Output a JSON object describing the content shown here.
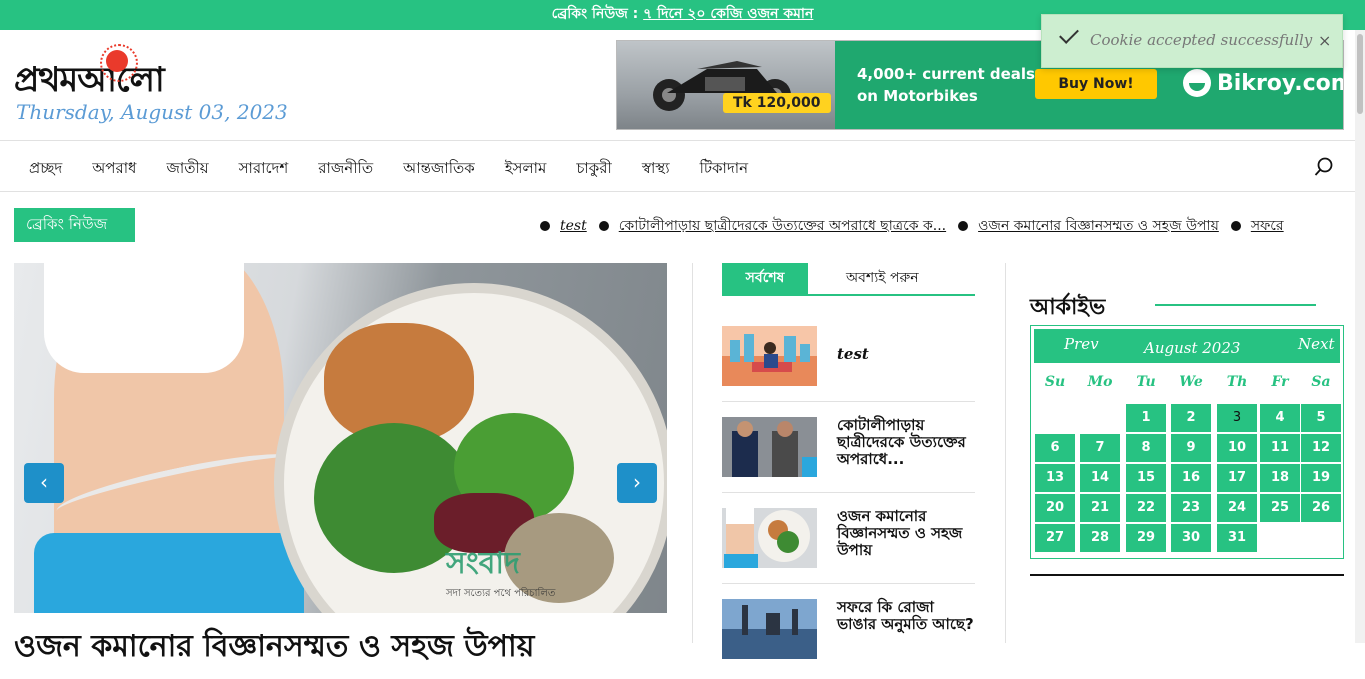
{
  "topbar": {
    "label": "ব্রেকিং নিউজ :",
    "link": "৭ দিনে ২০ কেজি ওজন কমান"
  },
  "header": {
    "logo_text": "প্রথমআলো",
    "date": "Thursday, August 03, 2023"
  },
  "ad": {
    "price": "Tk 120,000",
    "line1": "4,000+ current deals",
    "line2": "on Motorbikes",
    "button": "Buy Now!",
    "brand": "Bikroy.com",
    "colors": {
      "bg": "#1fa86f",
      "button": "#ffc800"
    }
  },
  "toast": {
    "message": "Cookie accepted successfully",
    "close": "×"
  },
  "nav": {
    "items": [
      "প্রচ্ছদ",
      "অপরাধ",
      "জাতীয়",
      "সারাদেশ",
      "রাজনীতি",
      "আন্তজাতিক",
      "ইসলাম",
      "চাকুরী",
      "স্বাস্থ্য",
      "টিকাদান"
    ]
  },
  "breaking": {
    "label": "ব্রেকিং নিউজ",
    "items": [
      "test",
      "কোটালীপাড়ায় ছাত্রীদেরকে উত্যক্তের অপরাধে ছাত্রকে ক...",
      "ওজন কমানোর বিজ্ঞানসম্মত ও সহজ উপায়",
      "সফরে"
    ]
  },
  "slider": {
    "headline": "ওজন কমানোর বিজ্ঞানসম্মত ও সহজ উপায়",
    "watermark": "সংবাদ",
    "watermark_tagline": "সদা সত্যের পথে পরিচালিত",
    "prev": "‹",
    "next": "›"
  },
  "tabs": {
    "active": "সর্বশেষ",
    "other": "অবশ্যই পরুন"
  },
  "posts": [
    {
      "title": "test"
    },
    {
      "title": "কোটালীপাড়ায় ছাত্রীদেরকে উত্যক্তের অপরাধে..."
    },
    {
      "title": "ওজন কমানোর বিজ্ঞানসম্মত ও সহজ উপায়"
    },
    {
      "title": "সফরে কি রোজা ভাঙার অনুমতি আছে?"
    }
  ],
  "archive": {
    "title": "আর্কাইভ",
    "calendar": {
      "prev": "Prev",
      "next": "Next",
      "month": "August 2023",
      "weekdays": [
        "Su",
        "Mo",
        "Tu",
        "We",
        "Th",
        "Fr",
        "Sa"
      ],
      "first_weekday_index": 2,
      "days_in_month": 31,
      "today": 3
    }
  },
  "colors": {
    "accent": "#27c282",
    "slider_arrow": "#1e90c9",
    "date": "#5b9bd5"
  }
}
